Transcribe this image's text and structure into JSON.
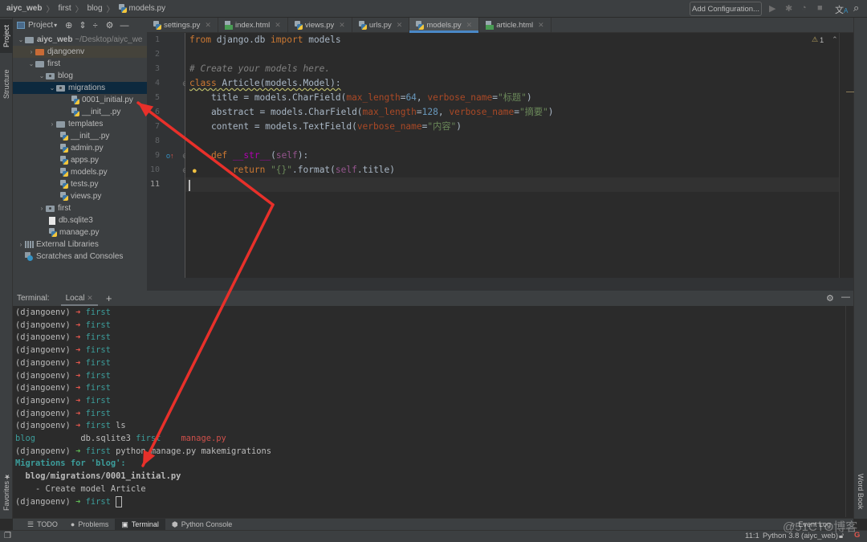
{
  "breadcrumb": [
    {
      "label": "aiyc_web"
    },
    {
      "label": "first"
    },
    {
      "label": "blog"
    },
    {
      "label": "models.py"
    }
  ],
  "toolbar": {
    "add_configuration_label": "Add Configuration...",
    "run_icon": "play-icon",
    "debug_icon": "bug-icon",
    "coverage_icon": "coverage-icon",
    "stop_icon": "stop-icon",
    "translate_icon": "translate-icon",
    "search_icon": "search-icon"
  },
  "left_strip": {
    "project_label": "Project",
    "structure_label": "Structure",
    "favorites_label": "Favorites"
  },
  "right_strip": {
    "wordbook_label": "Word Book"
  },
  "project_panel": {
    "title": "Project",
    "tree": [
      {
        "label": "aiyc_web",
        "hint": "~/Desktop/aiyc_we",
        "depth": 0,
        "type": "folder",
        "expanded": true
      },
      {
        "label": "djangoenv",
        "depth": 1,
        "type": "folder-excluded",
        "expanded": false
      },
      {
        "label": "first",
        "depth": 1,
        "type": "folder",
        "expanded": true
      },
      {
        "label": "blog",
        "depth": 2,
        "type": "package",
        "expanded": true
      },
      {
        "label": "migrations",
        "depth": 3,
        "type": "package",
        "expanded": true,
        "selected": true
      },
      {
        "label": "0001_initial.py",
        "depth": 4,
        "type": "python"
      },
      {
        "label": "__init__.py",
        "depth": 4,
        "type": "python"
      },
      {
        "label": "templates",
        "depth": 3,
        "type": "folder",
        "expanded": false
      },
      {
        "label": "__init__.py",
        "depth": 3,
        "type": "python"
      },
      {
        "label": "admin.py",
        "depth": 3,
        "type": "python"
      },
      {
        "label": "apps.py",
        "depth": 3,
        "type": "python"
      },
      {
        "label": "models.py",
        "depth": 3,
        "type": "python"
      },
      {
        "label": "tests.py",
        "depth": 3,
        "type": "python"
      },
      {
        "label": "views.py",
        "depth": 3,
        "type": "python"
      },
      {
        "label": "first",
        "depth": 2,
        "type": "package",
        "expanded": false
      },
      {
        "label": "db.sqlite3",
        "depth": 2,
        "type": "file"
      },
      {
        "label": "manage.py",
        "depth": 2,
        "type": "python"
      },
      {
        "label": "External Libraries",
        "depth": 0,
        "type": "library",
        "expanded": false
      },
      {
        "label": "Scratches and Consoles",
        "depth": 0,
        "type": "scratches"
      }
    ]
  },
  "editor_tabs": [
    {
      "label": "settings.py",
      "type": "python",
      "active": false
    },
    {
      "label": "index.html",
      "type": "html",
      "active": false
    },
    {
      "label": "views.py",
      "type": "python",
      "active": false
    },
    {
      "label": "urls.py",
      "type": "python",
      "active": false
    },
    {
      "label": "models.py",
      "type": "python",
      "active": true
    },
    {
      "label": "article.html",
      "type": "html",
      "active": false
    }
  ],
  "editor": {
    "warning_count": "1",
    "line_numbers": [
      "1",
      "2",
      "3",
      "4",
      "5",
      "6",
      "7",
      "8",
      "9",
      "10",
      "11"
    ],
    "current_line": 11,
    "lines": [
      "from django.db import models",
      "",
      "# Create your models here.",
      "class Article(models.Model):",
      "    title = models.CharField(max_length=64, verbose_name=\"标题\")",
      "    abstract = models.CharField(max_length=128, verbose_name=\"摘要\")",
      "    content = models.TextField(verbose_name=\"内容\")",
      "",
      "    def __str__(self):",
      "        return \"{}\".format(self.title)",
      ""
    ]
  },
  "terminal": {
    "label": "Terminal:",
    "tab_label": "Local",
    "env": "(djangoenv)",
    "dir": "first",
    "lines": [
      {
        "kind": "prompt",
        "status": "error",
        "cmd": ""
      },
      {
        "kind": "prompt",
        "status": "error",
        "cmd": ""
      },
      {
        "kind": "prompt",
        "status": "error",
        "cmd": ""
      },
      {
        "kind": "prompt",
        "status": "error",
        "cmd": ""
      },
      {
        "kind": "prompt",
        "status": "error",
        "cmd": ""
      },
      {
        "kind": "prompt",
        "status": "error",
        "cmd": ""
      },
      {
        "kind": "prompt",
        "status": "error",
        "cmd": ""
      },
      {
        "kind": "prompt",
        "status": "error",
        "cmd": ""
      },
      {
        "kind": "prompt",
        "status": "error",
        "cmd": ""
      },
      {
        "kind": "prompt",
        "status": "error",
        "cmd": "ls"
      },
      {
        "kind": "ls",
        "items": [
          "blog",
          "db.sqlite3",
          "first",
          "manage.py"
        ]
      },
      {
        "kind": "prompt",
        "status": "ok",
        "cmd": "python manage.py makemigrations"
      },
      {
        "kind": "output-cyan",
        "text": "Migrations for 'blog':"
      },
      {
        "kind": "output-bold",
        "text": "  blog/migrations/0001_initial.py"
      },
      {
        "kind": "output",
        "text": "    - Create model Article"
      },
      {
        "kind": "prompt",
        "status": "ok",
        "cmd": "",
        "cursor": true
      }
    ]
  },
  "bottom_tabs": [
    {
      "label": "TODO",
      "icon": "list-icon",
      "active": false
    },
    {
      "label": "Problems",
      "icon": "alert-icon",
      "active": false
    },
    {
      "label": "Terminal",
      "icon": "terminal-icon",
      "active": true
    },
    {
      "label": "Python Console",
      "icon": "python-icon",
      "active": false
    }
  ],
  "status_bar": {
    "event_log_label": "Event Log",
    "position": "11:1",
    "interpreter": "Python 3.8 (aiyc_web)",
    "watermark": "@51CTO博客"
  },
  "annotation_color": "#e8302a"
}
